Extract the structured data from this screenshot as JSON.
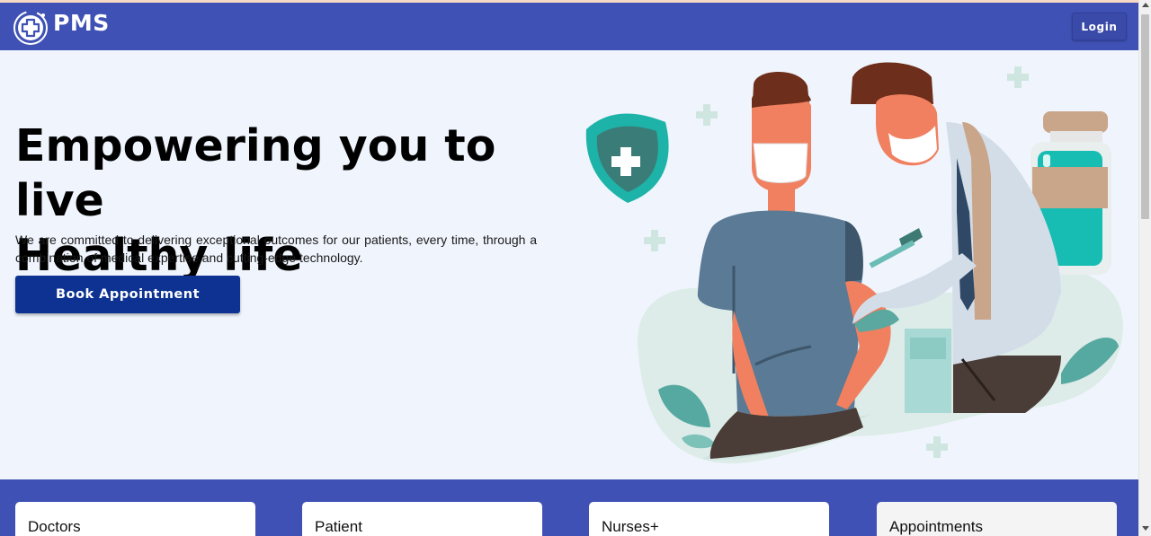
{
  "header": {
    "brand": "PMS",
    "logo_icon": "medical-cross-logo-icon",
    "login_label": "Login",
    "bar_color": "#3f51b5"
  },
  "hero": {
    "title_line1": "Empowering you to live",
    "title_line2": "Healthy life",
    "subtitle": "We are committed to delivering exceptional outcomes for our patients, every time, through a combination of medical expertise and cutting-edge technology.",
    "cta_label": "Book Appointment",
    "cta_color": "#0d3291",
    "illustration": "doctor-vaccinating-patient-illustration"
  },
  "services": {
    "cards": [
      {
        "label": "Doctors"
      },
      {
        "label": "Patient"
      },
      {
        "label": "Nurses+"
      },
      {
        "label": "Appointments"
      }
    ]
  }
}
